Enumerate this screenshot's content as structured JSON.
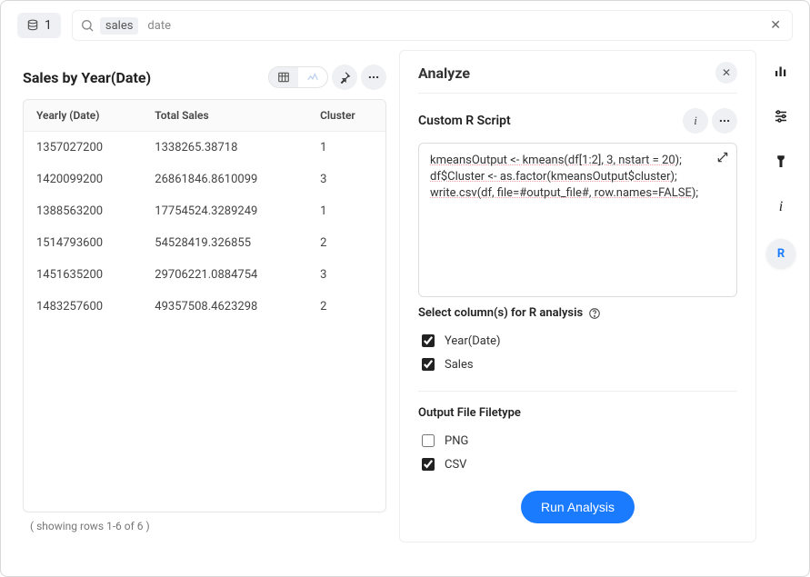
{
  "topbar": {
    "db_count": "1",
    "search_chips": [
      "sales",
      "date"
    ]
  },
  "left": {
    "title": "Sales by Year(Date)",
    "columns": [
      "Yearly (Date)",
      "Total Sales",
      "Cluster"
    ],
    "rows": [
      [
        "1357027200",
        "1338265.38718",
        "1"
      ],
      [
        "1420099200",
        "26861846.8610099",
        "3"
      ],
      [
        "1388563200",
        "17754524.3289249",
        "1"
      ],
      [
        "1514793600",
        "54528419.326855",
        "2"
      ],
      [
        "1451635200",
        "29706221.0884754",
        "3"
      ],
      [
        "1483257600",
        "49357508.4623298",
        "2"
      ]
    ],
    "footer": "( showing rows 1-6 of 6 )"
  },
  "analyze": {
    "title": "Analyze",
    "subtitle": "Custom R Script",
    "script_lines": [
      "kmeansOutput <- kmeans(df[1:2], 3, nstart = 20);",
      "df$Cluster <- as.factor(kmeansOutput$cluster);",
      "write.csv(df, file=#output_file#, row.names=FALSE);"
    ],
    "select_cols_label": "Select column(s) for R analysis",
    "selectable_columns": [
      {
        "label": "Year(Date)",
        "checked": true
      },
      {
        "label": "Sales",
        "checked": true
      }
    ],
    "output_label": "Output File Filetype",
    "output_types": [
      {
        "label": "PNG",
        "checked": false
      },
      {
        "label": "CSV",
        "checked": true
      }
    ],
    "run_label": "Run Analysis"
  },
  "rail": {
    "active_label": "R"
  }
}
